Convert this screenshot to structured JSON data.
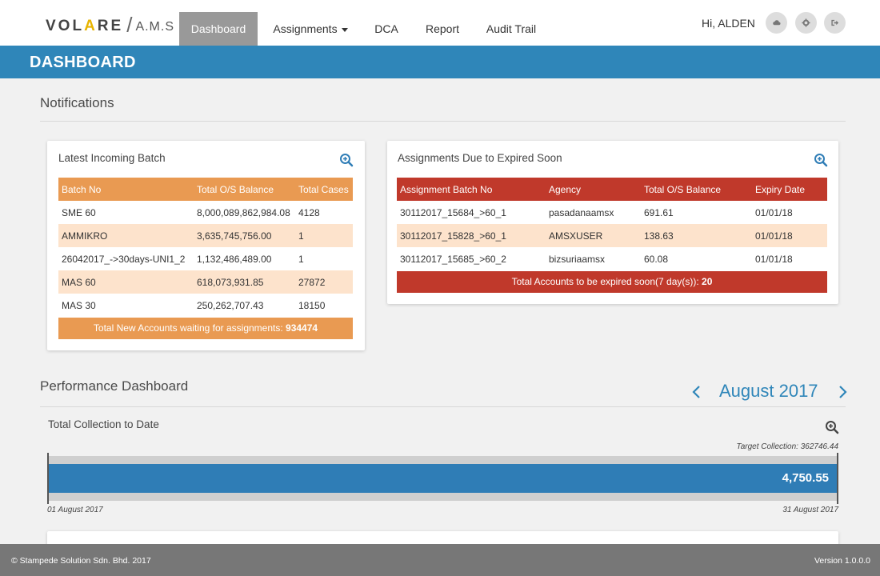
{
  "app": {
    "logo_brand_a": "VOL",
    "logo_brand_star": "A",
    "logo_brand_b": "RE",
    "logo_slash": "/",
    "logo_suffix": "A.M.S"
  },
  "nav": {
    "items": [
      {
        "label": "Dashboard",
        "active": true
      },
      {
        "label": "Assignments"
      },
      {
        "label": "DCA"
      },
      {
        "label": "Report"
      },
      {
        "label": "Audit Trail"
      }
    ],
    "greeting": "Hi, ALDEN",
    "icons": [
      "cloud-icon",
      "gear-icon",
      "logout-icon"
    ]
  },
  "banner": {
    "title": "DASHBOARD"
  },
  "notifications": {
    "title": "Notifications",
    "latest_batch": {
      "title": "Latest Incoming Batch",
      "columns": [
        "Batch No",
        "Total O/S Balance",
        "Total Cases"
      ],
      "rows": [
        [
          "SME 60",
          "8,000,089,862,984.08",
          "4128"
        ],
        [
          "AMMIKRO",
          "3,635,745,756.00",
          "1"
        ],
        [
          "26042017_->30days-UNI1_2",
          "1,132,486,489.00",
          "1"
        ],
        [
          "MAS 60",
          "618,073,931.85",
          "27872"
        ],
        [
          "MAS 30",
          "250,262,707.43",
          "18150"
        ]
      ],
      "footer_text": "Total New Accounts waiting for assignments: ",
      "footer_value": "934474",
      "accent": "#e99a52",
      "stripe": "#fde3cc"
    },
    "expiring": {
      "title": "Assignments Due to Expired Soon",
      "columns": [
        "Assignment Batch No",
        "Agency",
        "Total O/S Balance",
        "Expiry Date"
      ],
      "rows": [
        [
          "30112017_15684_>60_1",
          "pasadanaamsx",
          "691.61",
          "01/01/18"
        ],
        [
          "30112017_15828_>60_1",
          "AMSXUSER",
          "138.63",
          "01/01/18"
        ],
        [
          "30112017_15685_>60_2",
          "bizsuriaamsx",
          "60.08",
          "01/01/18"
        ]
      ],
      "footer_text": "Total Accounts to be expired soon(7 day(s)): ",
      "footer_value": "20",
      "accent": "#c0392b",
      "stripe": "#fde3cc"
    }
  },
  "performance": {
    "title": "Performance Dashboard",
    "month": "August 2017",
    "prev": "‹",
    "next": "›",
    "collection": {
      "title": "Total Collection to Date",
      "target_label": "Target Collection: 362746.44",
      "value": "4,750.55",
      "start_label": "01 August 2017",
      "end_label": "31 August 2017",
      "bar_color": "#2f7db6"
    }
  },
  "statusbar": {
    "copyright": "© Stampede Solution Sdn. Bhd. 2017",
    "version": "Version 1.0.0.0"
  }
}
